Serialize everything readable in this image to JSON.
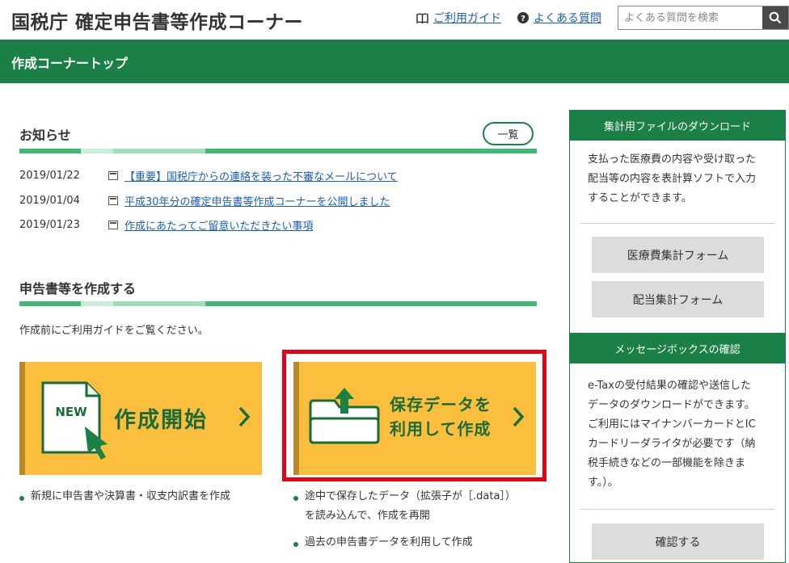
{
  "header": {
    "title": "国税庁 確定申告書等作成コーナー",
    "guide_link": "ご利用ガイド",
    "faq_link": "よくある質問",
    "search_placeholder": "よくある質問を検索"
  },
  "band": {
    "title": "作成コーナートップ"
  },
  "news": {
    "heading": "お知らせ",
    "more_label": "一覧",
    "items": [
      {
        "date": "2019/01/22",
        "text": "【重要】国税庁からの連絡を装った不審なメールについて"
      },
      {
        "date": "2019/01/04",
        "text": "平成30年分の確定申告書等作成コーナーを公開しました"
      },
      {
        "date": "2019/01/23",
        "text": "作成にあたってご留意いただきたい事項"
      }
    ]
  },
  "create": {
    "heading": "申告書等を作成する",
    "intro": "作成前にご利用ガイドをご覧ください。",
    "new_badge": "NEW",
    "start_label": "作成開始",
    "saved_label_line1": "保存データを",
    "saved_label_line2": "利用して作成",
    "start_bullet": "新規に申告書や決算書・収支内訳書を作成",
    "saved_bullet1_line1": "途中で保存したデータ（拡張子が［.data］）",
    "saved_bullet1_line2": "を読み込んで、作成を再開",
    "saved_bullet2": "過去の申告書データを利用して作成"
  },
  "sidebar": {
    "download": {
      "heading": "集計用ファイルのダウンロード",
      "text_lines": [
        "支払った医療費の内容や受け取った",
        "配当等の内容を表計算ソフトで入力",
        "することができます。"
      ],
      "btn_medical": "医療費集計フォーム",
      "btn_dividend": "配当集計フォーム"
    },
    "messagebox": {
      "heading": "メッセージボックスの確認",
      "text_lines": [
        "e-Taxの受付結果の確認や送信した",
        "データのダウンロードができます。",
        "ご利用にはマイナンバーカードとIC",
        "カードリーダライタが必要です（納",
        "税手続きなどの一部機能を除きま",
        "す。）。"
      ],
      "btn_confirm": "確認する"
    }
  },
  "colors": {
    "brand_green": "#1b8046",
    "card_yellow": "#fbbf3d",
    "link_blue": "#1a5fb4",
    "highlight_red": "#e60012"
  }
}
